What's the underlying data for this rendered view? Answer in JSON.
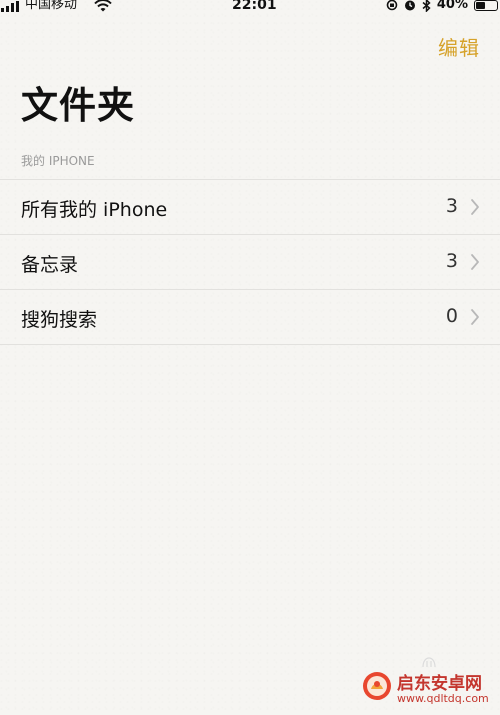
{
  "status_bar": {
    "carrier": "中国移动",
    "time": "22:01",
    "battery": "40%",
    "battery_level": 0.4
  },
  "nav": {
    "edit_label": "编辑"
  },
  "page": {
    "title": "文件夹",
    "section_header": "我的 IPHONE"
  },
  "folders": [
    {
      "name": "所有我的 iPhone",
      "count": "3"
    },
    {
      "name": "备忘录",
      "count": "3"
    },
    {
      "name": "搜狗搜索",
      "count": "0"
    }
  ],
  "watermark": {
    "name": "启东安卓网",
    "url": "www.qdltdq.com"
  },
  "colors": {
    "accent": "#d6a22a",
    "background": "#f6f5f2",
    "separator": "#e2e1de",
    "watermark": "#c4362e"
  }
}
